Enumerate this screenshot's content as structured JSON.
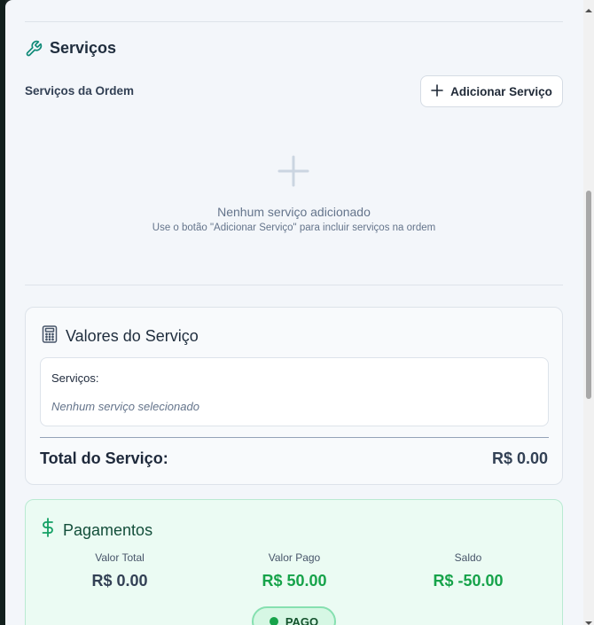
{
  "services_section": {
    "title": "Serviços",
    "subtitle": "Serviços da Ordem",
    "add_button_label": "Adicionar Serviço",
    "empty_title": "Nenhum serviço adicionado",
    "empty_hint": "Use o botão \"Adicionar Serviço\" para incluir serviços na ordem"
  },
  "valores": {
    "title": "Valores do Serviço",
    "services_label": "Serviços:",
    "services_empty": "Nenhum serviço selecionado",
    "total_label": "Total do Serviço:",
    "total_value": "R$ 0.00"
  },
  "pagamentos": {
    "title": "Pagamentos",
    "valor_total_label": "Valor Total",
    "valor_total": "R$ 0.00",
    "valor_pago_label": "Valor Pago",
    "valor_pago": "R$ 50.00",
    "saldo_label": "Saldo",
    "saldo": "R$ -50.00",
    "status": "PAGO"
  },
  "icons": {
    "services": "wrench-icon",
    "valores": "calculator-icon",
    "pagamentos": "dollar-icon",
    "add": "plus-icon",
    "empty": "plus-icon"
  },
  "colors": {
    "accent_teal": "#0f8a78",
    "money_green": "#16a34a",
    "pay_card_bg": "#ebfbf3"
  }
}
